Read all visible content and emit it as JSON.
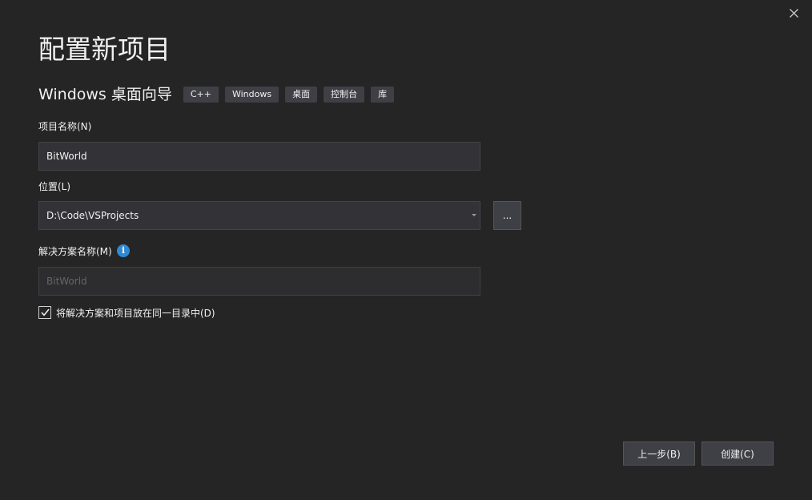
{
  "dialog": {
    "title": "配置新项目",
    "close_icon": "close-icon"
  },
  "template": {
    "name": "Windows 桌面向导",
    "tags": [
      "C++",
      "Windows",
      "桌面",
      "控制台",
      "库"
    ]
  },
  "project_name": {
    "label": "项目名称(N)",
    "value": "BitWorld"
  },
  "location": {
    "label": "位置(L)",
    "value": "D:\\Code\\VSProjects",
    "browse_label": "..."
  },
  "solution_name": {
    "label": "解决方案名称(M)",
    "info_icon": "info-icon",
    "info_glyph": "i",
    "placeholder": "BitWorld"
  },
  "same_directory": {
    "checked": true,
    "label": "将解决方案和项目放在同一目录中(D)"
  },
  "footer": {
    "back_label": "上一步(B)",
    "create_label": "创建(C)"
  },
  "colors": {
    "background": "#252526",
    "input_background": "#333337",
    "tag_background": "#3f3f46",
    "info_icon": "#2f8ad4"
  }
}
